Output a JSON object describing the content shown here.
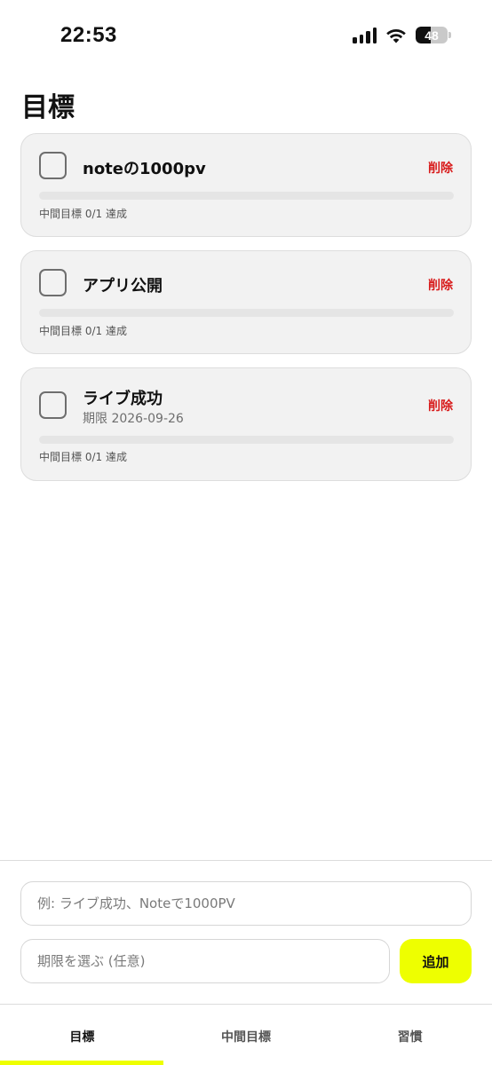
{
  "status_bar": {
    "time": "22:53",
    "battery": "48",
    "battery_level": 0.48
  },
  "page_title": "目標",
  "goals": [
    {
      "title": "noteの1000pv",
      "deadline": "",
      "progress_text": "中間目標 0/1 達成",
      "progress": 0,
      "delete_label": "削除"
    },
    {
      "title": "アプリ公開",
      "deadline": "",
      "progress_text": "中間目標 0/1 達成",
      "progress": 0,
      "delete_label": "削除"
    },
    {
      "title": "ライブ成功",
      "deadline": "期限 2026-09-26",
      "progress_text": "中間目標 0/1 達成",
      "progress": 0,
      "delete_label": "削除"
    }
  ],
  "input": {
    "goal_placeholder": "例: ライブ成功、Noteで1000PV",
    "goal_value": "",
    "deadline_placeholder": "期限を選ぶ (任意)",
    "deadline_value": "",
    "add_label": "追加"
  },
  "tabs": [
    {
      "label": "目標",
      "active": true
    },
    {
      "label": "中間目標",
      "active": false
    },
    {
      "label": "習慣",
      "active": false
    }
  ],
  "colors": {
    "accent": "#eeff00",
    "delete": "#d81b1b",
    "card_bg": "#f2f2f2"
  }
}
